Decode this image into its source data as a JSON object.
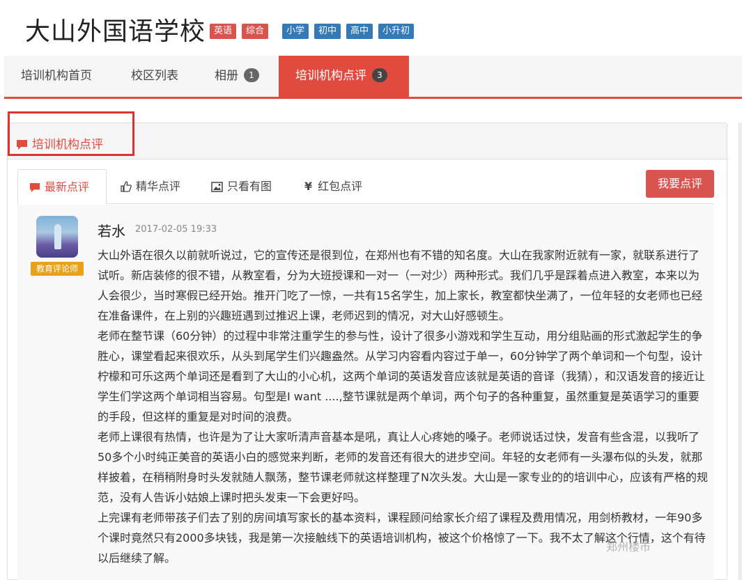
{
  "header": {
    "school_name": "大山外国语学校",
    "tags_red": [
      "英语",
      "综合"
    ],
    "tags_blue": [
      "小学",
      "初中",
      "高中",
      "小升初"
    ]
  },
  "nav": {
    "items": [
      {
        "label": "培训机构首页",
        "badge": ""
      },
      {
        "label": "校区列表",
        "badge": ""
      },
      {
        "label": "相册",
        "badge": "1"
      },
      {
        "label": "培训机构点评",
        "badge": "3"
      }
    ]
  },
  "panel": {
    "title": "培训机构点评"
  },
  "tabs": {
    "items": [
      {
        "label": "最新点评"
      },
      {
        "label": "精华点评"
      },
      {
        "label": "只看有图"
      },
      {
        "label": "红包点评"
      }
    ],
    "write_review": "我要点评"
  },
  "review": {
    "username": "若水",
    "timestamp": "2017-02-05 19:33",
    "role": "教育评论师",
    "paragraphs": [
      "大山外语在很久以前就听说过，它的宣传还是很到位，在郑州也有不错的知名度。大山在我家附近就有一家，就联系进行了试听。新店装修的很不错，从教室看，分为大班授课和一对一（一对少）两种形式。我们几乎是踩着点进入教室，本来以为人会很少，当时寒假已经开始。推开门吃了一惊，一共有15名学生，加上家长，教室都快坐满了，一位年轻的女老师也已经在准备课件，在上别的兴趣班遇到过推迟上课，老师迟到的情况，对大山好感顿生。",
      "老师在整节课（60分钟）的过程中非常注重学生的参与性，设计了很多小游戏和学生互动，用分组贴画的形式激起学生的争胜心，课堂看起来很欢乐，从头到尾学生们兴趣盎然。从学习内容看内容过于单一，60分钟学了两个单词和一个句型，设计柠檬和可乐这两个单词还是看到了大山的小心机，这两个单词的英语发音应该就是英语的音译（我猜），和汉语发音的接近让学生们学这两个单词相当容易。句型是I want ....,整节课就是两个单词，两个句子的各种重复，虽然重复是英语学习的重要的手段，但这样的重复是对时间的浪费。",
      "老师上课很有热情，也许是为了让大家听清声音基本是吼，真让人心疼她的嗓子。老师说话过快，发音有些含混，以我听了50多个小时纯正美音的英语小白的感觉来判断，老师的发音还有很大的进步空间。年轻的女老师有一头瀑布似的头发，就那样披着，在稍稍附身时头发就随人飘荡，整节课老师就这样整理了N次头发。大山是一家专业的的培训中心，应该有严格的规范，没有人告诉小姑娘上课时把头发束一下会更好吗。",
      "上完课有老师带孩子们去了别的房间填写家长的基本资料，课程顾问给家长介绍了课程及费用情况，用剑桥教材，一年90多个课时竟然只有2000多块钱，我是第一次接触线下的英语培训机构，被这个价格惊了一下。我不太了解这个行情，这个有待以后继续了解。"
    ]
  },
  "watermark": "郑州楼市",
  "colors": {
    "accent": "#e04a3f",
    "tag_red": "#d9534f",
    "tag_blue": "#337ab7",
    "role_badge": "#e8a21a"
  }
}
